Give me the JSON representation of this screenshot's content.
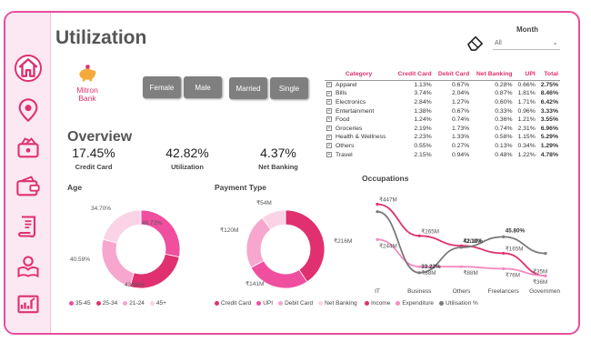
{
  "page": {
    "title": "Utilization",
    "overview_title": "Overview"
  },
  "brand": {
    "name_line1": "Mitron",
    "name_line2": "Bank",
    "accent": "#e0306f",
    "frame": "#e64e9b"
  },
  "sidebar": {
    "items": [
      {
        "name": "home-icon"
      },
      {
        "name": "location-pin-icon"
      },
      {
        "name": "wallet-cash-icon"
      },
      {
        "name": "wallet-icon"
      },
      {
        "name": "scroll-bill-icon"
      },
      {
        "name": "ledger-book-icon"
      },
      {
        "name": "dashboard-chart-icon"
      }
    ]
  },
  "filters": {
    "month_label": "Month",
    "month_value": "All",
    "gender": [
      "Female",
      "Male"
    ],
    "marital": [
      "Married",
      "Single"
    ]
  },
  "kpis": [
    {
      "value": "17.45%",
      "label": "Credit Card"
    },
    {
      "value": "42.82%",
      "label": "Utilization"
    },
    {
      "value": "4.37%",
      "label": "Net Banking"
    }
  ],
  "category_table": {
    "headers": [
      "Category",
      "Credit Card",
      "Debit Card",
      "Net Banking",
      "UPI",
      "Total"
    ],
    "rows": [
      [
        "Apparel",
        "1.13%",
        "0.67%",
        "0.28%",
        "0.66%",
        "2.75%"
      ],
      [
        "Bills",
        "3.74%",
        "2.04%",
        "0.87%",
        "1.81%",
        "8.46%"
      ],
      [
        "Electronics",
        "2.84%",
        "1.27%",
        "0.60%",
        "1.71%",
        "6.42%"
      ],
      [
        "Entertainment",
        "1.38%",
        "0.67%",
        "0.33%",
        "0.96%",
        "3.33%"
      ],
      [
        "Food",
        "1.24%",
        "0.74%",
        "0.36%",
        "1.21%",
        "3.55%"
      ],
      [
        "Groceries",
        "2.19%",
        "1.73%",
        "0.74%",
        "2.31%",
        "6.96%"
      ],
      [
        "Health & Wellness",
        "2.23%",
        "1.33%",
        "0.58%",
        "1.15%",
        "5.29%"
      ],
      [
        "Others",
        "0.55%",
        "0.27%",
        "0.13%",
        "0.34%",
        "1.29%"
      ],
      [
        "Travel",
        "2.15%",
        "0.94%",
        "0.48%",
        "1.22%",
        "4.78%"
      ]
    ]
  },
  "chart_data": [
    {
      "type": "pie",
      "title": "Age",
      "donut": true,
      "categories": [
        "35-45",
        "25-34",
        "21-24",
        "45+"
      ],
      "values": [
        46.72,
        43.66,
        40.59,
        34.7
      ],
      "labels": [
        "46.72%",
        "43.66%",
        "40.59%",
        "34.70%"
      ],
      "colors": [
        "#f04fa0",
        "#e0306f",
        "#f7a6cd",
        "#fbd3e6"
      ],
      "legend": "bottom"
    },
    {
      "type": "pie",
      "title": "Payment Type",
      "donut": true,
      "categories": [
        "Credit Card",
        "UPI",
        "Debit Card",
        "Net Banking"
      ],
      "values": [
        216,
        141,
        120,
        54
      ],
      "labels": [
        "₹216M",
        "₹141M",
        "₹120M",
        "₹54M"
      ],
      "colors": [
        "#e0306f",
        "#f04fa0",
        "#f7a6cd",
        "#fbd3e6"
      ],
      "legend": "bottom"
    },
    {
      "type": "line",
      "title": "Occupations",
      "categories": [
        "IT",
        "Business",
        "Others",
        "Freelancers",
        "Government"
      ],
      "series": [
        {
          "name": "Income",
          "values": [
            447,
            265,
            208,
            165,
            35
          ],
          "labels": [
            "₹447M",
            "₹265M",
            "₹208M",
            "₹165M",
            "₹35M"
          ],
          "color": "#e0306f"
        },
        {
          "name": "Expenditure",
          "values": [
            244,
            88,
            88,
            76,
            36
          ],
          "labels": [
            "₹244M",
            "₹88M",
            "₹88M",
            "₹76M",
            "₹36M"
          ],
          "color": "#f28cbf"
        },
        {
          "name": "Utilisation %",
          "values": [
            54.6,
            33.22,
            42.1,
            45.8,
            40.0
          ],
          "labels": [
            "",
            "33.22%",
            "42.10%",
            "45.80%",
            ""
          ],
          "color": "#7a7a7a",
          "axis": "secondary"
        }
      ],
      "legend": "bottom"
    }
  ]
}
